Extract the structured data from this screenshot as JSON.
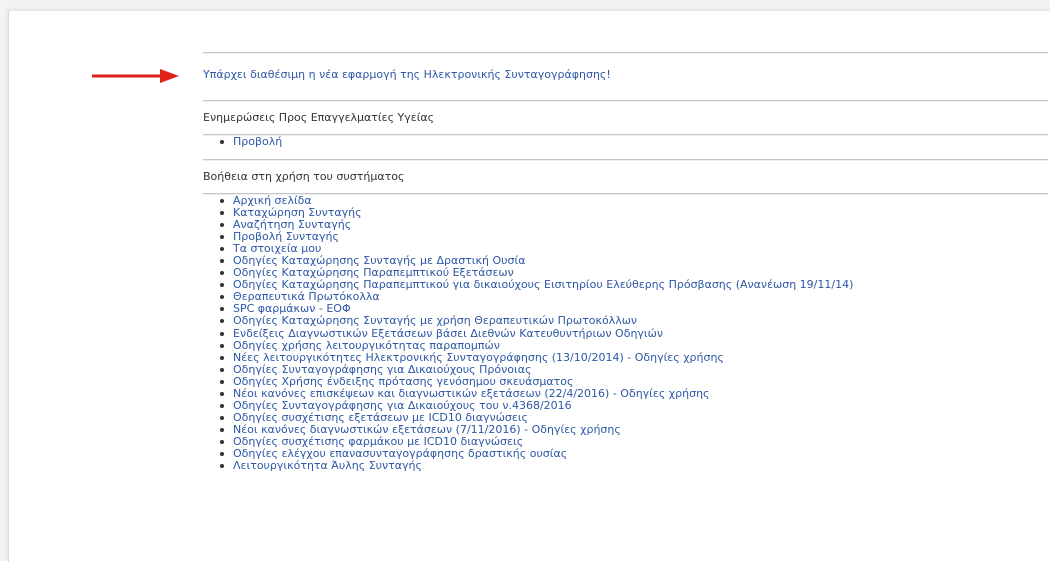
{
  "announcement": "Υπάρχει διαθέσιμη η νέα εφαρμογή της Ηλεκτρονικής Συνταγογράφησης!",
  "updates_section": {
    "title": "Ενημερώσεις Προς Επαγγελματίες Υγείας",
    "items": [
      {
        "label": "Προβολή"
      }
    ]
  },
  "help_section": {
    "title": "Βοήθεια στη χρήση του συστήματος",
    "items": [
      {
        "label": "Αρχική σελίδα"
      },
      {
        "label": "Καταχώρηση Συνταγής"
      },
      {
        "label": "Αναζήτηση Συνταγής"
      },
      {
        "label": "Προβολή Συνταγής"
      },
      {
        "label": "Τα στοιχεία μου"
      },
      {
        "label": "Οδηγίες Καταχώρησης Συνταγής με Δραστική Ουσία"
      },
      {
        "label": "Οδηγίες Καταχώρησης Παραπεμπτικού Εξετάσεων"
      },
      {
        "label": "Οδηγίες Καταχώρησης Παραπεμπτικού για δικαιούχους Εισιτηρίου Ελεύθερης Πρόσβασης (Ανανέωση 19/11/14)"
      },
      {
        "label": "Θεραπευτικά Πρωτόκολλα"
      },
      {
        "label": "SPC φαρμάκων - ΕΟΦ"
      },
      {
        "label": "Οδηγίες Καταχώρησης Συνταγής με χρήση Θεραπευτικών Πρωτοκόλλων"
      },
      {
        "label": "Ενδείξεις Διαγνωστικών Εξετάσεων βάσει Διεθνών Κατευθυντήριων Οδηγιών"
      },
      {
        "label": "Οδηγίες χρήσης λειτουργικότητας παραπομπών"
      },
      {
        "label": "Νέες λειτουργικότητες Ηλεκτρονικής Συνταγογράφησης (13/10/2014) - Οδηγίες χρήσης"
      },
      {
        "label": "Οδηγίες Συνταγογράφησης για Δικαιούχους Πρόνοιας"
      },
      {
        "label": "Οδηγίες Χρήσης ένδειξης πρότασης γενόσημου σκευάσματος"
      },
      {
        "label": "Νέοι κανόνες επισκέψεων και διαγνωστικών εξετάσεων (22/4/2016) - Οδηγίες χρήσης"
      },
      {
        "label": "Οδηγίες Συνταγογράφησης για Δικαιούχους του ν.4368/2016"
      },
      {
        "label": "Οδηγίες συσχέτισης εξετάσεων με ICD10 διαγνώσεις"
      },
      {
        "label": "Νέοι κανόνες διαγνωστικών εξετάσεων (7/11/2016) - Οδηγίες χρήσης"
      },
      {
        "label": "Οδηγίες συσχέτισης φαρμάκου με ICD10 διαγνώσεις"
      },
      {
        "label": "Οδηγίες ελέγχου επανασυνταγογράφησης δραστικής ουσίας"
      },
      {
        "label": "Λειτουργικότητα Άυλης Συνταγής"
      }
    ]
  },
  "colors": {
    "link": "#2d57a6",
    "arrow": "#e0211b",
    "text": "#333333"
  },
  "icons": {
    "arrow": "red-right-arrow-icon"
  }
}
